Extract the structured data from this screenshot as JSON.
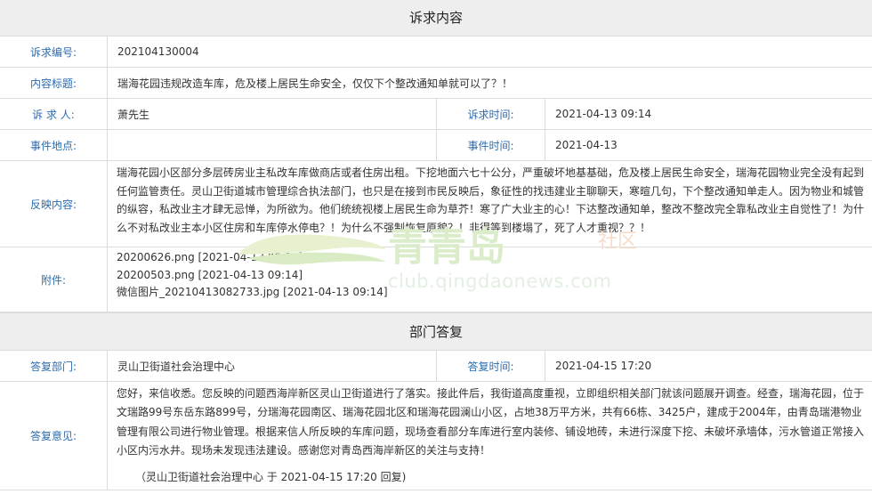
{
  "complaint": {
    "header": "诉求内容",
    "number_label": "诉求编号:",
    "number_value": "202104130004",
    "title_label": "内容标题:",
    "title_value": "瑞海花园违规改造车库，危及楼上居民生命安全，仅仅下个整改通知单就可以了？！",
    "person_label": "诉 求 人:",
    "person_value": "萧先生",
    "time_label": "诉求时间:",
    "time_value": "2021-04-13 09:14",
    "place_label": "事件地点:",
    "place_value": "",
    "event_time_label": "事件时间:",
    "event_time_value": "2021-04-13",
    "content_label": "反映内容:",
    "content_value": "瑞海花园小区部分多层砖房业主私改车库做商店或者住房出租。下挖地面六七十公分，严重破坏地基基础，危及楼上居民生命安全，瑞海花园物业完全没有起到任何监管责任。灵山卫街道城市管理综合执法部门，也只是在接到市民反映后，象征性的找违建业主聊聊天，寒暄几句，下个整改通知单走人。因为物业和城管的纵容，私改业主才肆无忌惮，为所欲为。他们统统视楼上居民生命为草芥！寒了广大业主的心！下达整改通知单，整改不整改完全靠私改业主自觉性了！为什么不对私改业主本小区住房和车库停水停电？！为什么不强制恢复原貌？！非得等到楼塌了，死了人才重视？？！",
    "attachment_label": "附件:",
    "attachments": [
      "20200626.png [2021-04-13 09:14]",
      "20200503.png [2021-04-13 09:14]",
      "微信图片_20210413082733.jpg [2021-04-13 09:14]"
    ]
  },
  "reply": {
    "header": "部门答复",
    "dept_label": "答复部门:",
    "dept_value": "灵山卫街道社会治理中心",
    "time_label": "答复时间:",
    "time_value": "2021-04-15 17:20",
    "opinion_label": "答复意见:",
    "opinion_value": "您好，来信收悉。您反映的问题西海岸新区灵山卫街道进行了落实。接此件后，我街道高度重视，立即组织相关部门就该问题展开调查。经查，瑞海花园，位于文瑞路99号东岳东路899号，分瑞海花园南区、瑞海花园北区和瑞海花园澜山小区，占地38万平方米，共有66栋、3425户，建成于2004年，由青岛瑞港物业管理有限公司进行物业管理。根据来信人所反映的车库问题，现场查看部分车库进行室内装修、铺设地砖，未进行深度下挖、未破坏承墙体，污水管道正常接入小区内污水井。现场未发现违法建设。感谢您对青岛西海岸新区的关注与支持！",
    "signature": "（灵山卫街道社会治理中心 于 2021-04-15 17:20 回复)"
  },
  "watermark": {
    "logo_text": "青青岛",
    "suffix": "社区",
    "url": "club.qingdaonews.com"
  },
  "colors": {
    "label_blue": "#2b6cb0",
    "header_bg": "#eeeeee",
    "border": "#dcdcdc"
  }
}
